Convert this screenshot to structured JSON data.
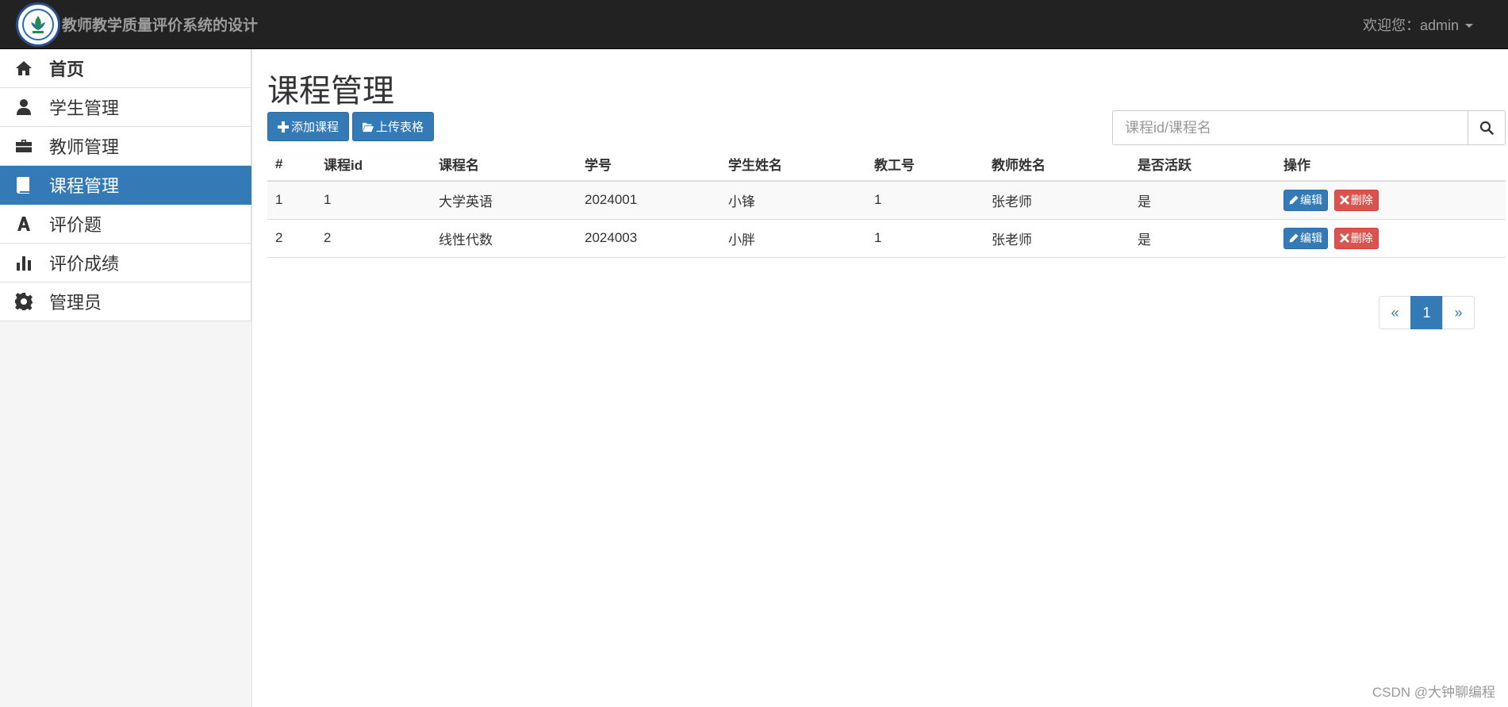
{
  "header": {
    "title": "教师教学质量评价系统的设计",
    "user_label": "欢迎您：admin"
  },
  "sidebar": {
    "items": [
      {
        "label": "首页",
        "icon": "home-icon"
      },
      {
        "label": "学生管理",
        "icon": "user-icon"
      },
      {
        "label": "教师管理",
        "icon": "briefcase-icon"
      },
      {
        "label": "课程管理",
        "icon": "book-icon",
        "active": true
      },
      {
        "label": "评价题",
        "icon": "font-icon"
      },
      {
        "label": "评价成绩",
        "icon": "bar-chart-icon"
      },
      {
        "label": "管理员",
        "icon": "gear-icon"
      }
    ]
  },
  "main": {
    "title": "课程管理",
    "add_label": "添加课程",
    "upload_label": "上传表格",
    "search": {
      "placeholder": "课程id/课程名",
      "value": ""
    },
    "columns": [
      "#",
      "课程id",
      "课程名",
      "学号",
      "学生姓名",
      "教工号",
      "教师姓名",
      "是否活跃",
      "操作"
    ],
    "rows": [
      {
        "idx": "1",
        "course_id": "1",
        "course_name": "大学英语",
        "student_no": "2024001",
        "student_name": "小锋",
        "teacher_no": "1",
        "teacher_name": "张老师",
        "active": "是"
      },
      {
        "idx": "2",
        "course_id": "2",
        "course_name": "线性代数",
        "student_no": "2024003",
        "student_name": "小胖",
        "teacher_no": "1",
        "teacher_name": "张老师",
        "active": "是"
      }
    ],
    "edit_label": "编辑",
    "delete_label": "删除",
    "pagination": {
      "prev": "«",
      "current": "1",
      "next": "»"
    }
  },
  "watermark": "CSDN @大钟聊编程",
  "colors": {
    "primary": "#337ab7",
    "danger": "#d9534f",
    "navbar": "#222222"
  }
}
